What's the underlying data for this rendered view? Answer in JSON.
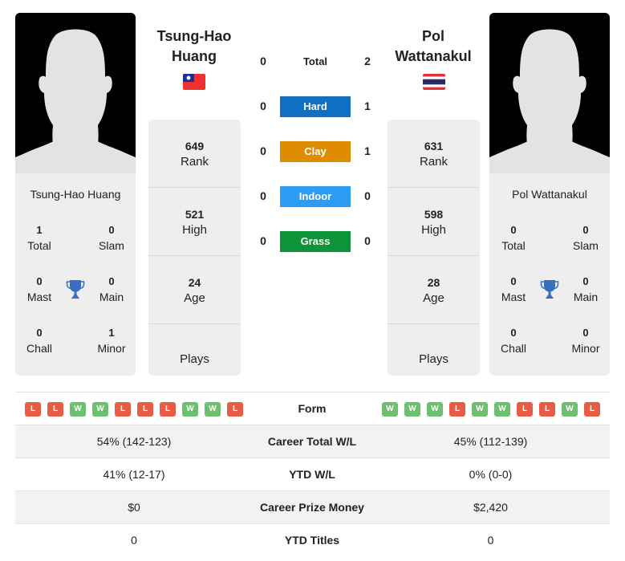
{
  "players": [
    {
      "name_line1": "Tsung-Hao",
      "name_line2": "Huang",
      "full_name": "Tsung-Hao Huang",
      "flag": "taiwan-flag",
      "stats": {
        "rank": "649",
        "rank_label": "Rank",
        "high": "521",
        "high_label": "High",
        "age": "24",
        "age_label": "Age",
        "plays_label": "Plays"
      },
      "titles": {
        "total": "1",
        "total_label": "Total",
        "slam": "0",
        "slam_label": "Slam",
        "mast": "0",
        "mast_label": "Mast",
        "main": "0",
        "main_label": "Main",
        "chall": "0",
        "chall_label": "Chall",
        "minor": "1",
        "minor_label": "Minor"
      },
      "form": [
        "L",
        "L",
        "W",
        "W",
        "L",
        "L",
        "L",
        "W",
        "W",
        "L"
      ]
    },
    {
      "name_line1": "Pol",
      "name_line2": "Wattanakul",
      "full_name": "Pol Wattanakul",
      "flag": "thailand-flag",
      "stats": {
        "rank": "631",
        "rank_label": "Rank",
        "high": "598",
        "high_label": "High",
        "age": "28",
        "age_label": "Age",
        "plays_label": "Plays"
      },
      "titles": {
        "total": "0",
        "total_label": "Total",
        "slam": "0",
        "slam_label": "Slam",
        "mast": "0",
        "mast_label": "Mast",
        "main": "0",
        "main_label": "Main",
        "chall": "0",
        "chall_label": "Chall",
        "minor": "0",
        "minor_label": "Minor"
      },
      "form": [
        "W",
        "W",
        "W",
        "L",
        "W",
        "W",
        "L",
        "L",
        "W",
        "L"
      ]
    }
  ],
  "h2h": [
    {
      "label": "Total",
      "a": "0",
      "b": "2",
      "color": null
    },
    {
      "label": "Hard",
      "a": "0",
      "b": "1",
      "color": "#0e6fc4"
    },
    {
      "label": "Clay",
      "a": "0",
      "b": "1",
      "color": "#de8c00"
    },
    {
      "label": "Indoor",
      "a": "0",
      "b": "0",
      "color": "#2d9cf7"
    },
    {
      "label": "Grass",
      "a": "0",
      "b": "0",
      "color": "#0d9439"
    }
  ],
  "comparison": {
    "form_label": "Form",
    "rows": [
      {
        "label": "Career Total W/L",
        "a": "54% (142-123)",
        "b": "45% (112-139)"
      },
      {
        "label": "YTD W/L",
        "a": "41% (12-17)",
        "b": "0% (0-0)"
      },
      {
        "label": "Career Prize Money",
        "a": "$0",
        "b": "$2,420"
      },
      {
        "label": "YTD Titles",
        "a": "0",
        "b": "0"
      }
    ]
  },
  "colors": {
    "win": "#6fbf73",
    "loss": "#e85c45",
    "trophy": "#3a6fc0"
  }
}
